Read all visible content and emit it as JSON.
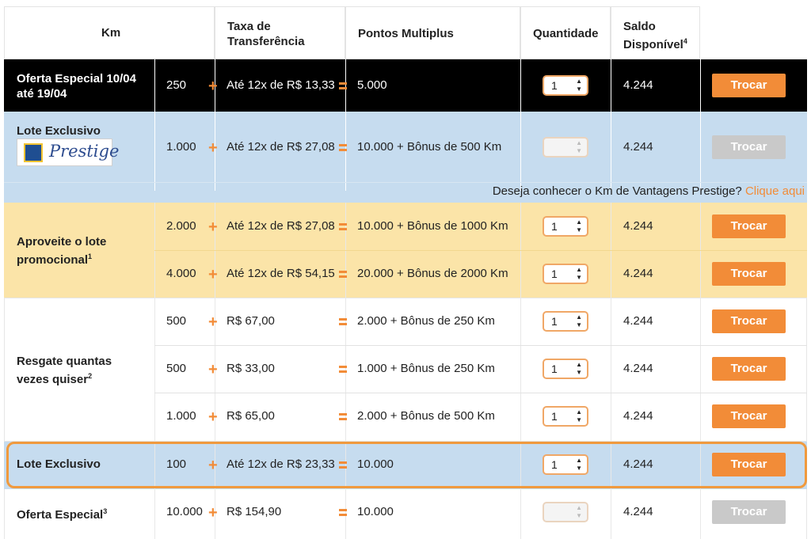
{
  "headers": {
    "km": "Km",
    "taxa": "Taxa de Transferência",
    "pontos": "Pontos Multiplus",
    "quantidade": "Quantidade",
    "saldo": "Saldo Disponível",
    "saldo_sup": "4"
  },
  "rows": [
    {
      "label": "Oferta Especial 10/04 até 19/04",
      "km": "250",
      "taxa": "Até 12x de R$ 13,33",
      "pontos": "5.000",
      "qty": "1",
      "saldo": "4.244",
      "button": "Trocar"
    },
    {
      "label": "Lote Exclusivo",
      "km": "1.000",
      "taxa": "Até 12x de R$ 27,08",
      "pontos": "10.000 + Bônus de 500 Km",
      "qty": "",
      "saldo": "4.244",
      "button": "Trocar"
    },
    {
      "label": "Aproveite o lote promocional",
      "label_sup": "1",
      "km": "2.000",
      "taxa": "Até 12x de R$ 27,08",
      "pontos": "10.000 + Bônus de 1000 Km",
      "qty": "1",
      "saldo": "4.244",
      "button": "Trocar"
    },
    {
      "km": "4.000",
      "taxa": "Até 12x de R$ 54,15",
      "pontos": "20.000 + Bônus de 2000 Km",
      "qty": "1",
      "saldo": "4.244",
      "button": "Trocar"
    },
    {
      "label": "Resgate quantas vezes quiser",
      "label_sup": "2",
      "km": "500",
      "taxa": "R$ 67,00",
      "pontos": "2.000 + Bônus de 250 Km",
      "qty": "1",
      "saldo": "4.244",
      "button": "Trocar"
    },
    {
      "km": "500",
      "taxa": "R$ 33,00",
      "pontos": "1.000 + Bônus de 250 Km",
      "qty": "1",
      "saldo": "4.244",
      "button": "Trocar"
    },
    {
      "km": "1.000",
      "taxa": "R$ 65,00",
      "pontos": "2.000 + Bônus de 500 Km",
      "qty": "1",
      "saldo": "4.244",
      "button": "Trocar"
    },
    {
      "label": "Lote Exclusivo",
      "km": "100",
      "taxa": "Até 12x de R$ 23,33",
      "pontos": "10.000",
      "qty": "1",
      "saldo": "4.244",
      "button": "Trocar"
    },
    {
      "label": "Oferta Especial",
      "label_sup": "3",
      "km": "10.000",
      "taxa": "R$ 154,90",
      "pontos": "10.000",
      "qty": "",
      "saldo": "4.244",
      "button": "Trocar"
    }
  ],
  "prestige": {
    "logo_text": "Prestige",
    "question": "Deseja conhecer o Km de Vantagens Prestige?",
    "link": "Clique aqui"
  },
  "colors": {
    "accent": "#f28c38",
    "black_row": "#000000",
    "blue_row": "#c6dcef",
    "yellow_row": "#fbe4a8",
    "highlight_border": "#f09a3e"
  }
}
